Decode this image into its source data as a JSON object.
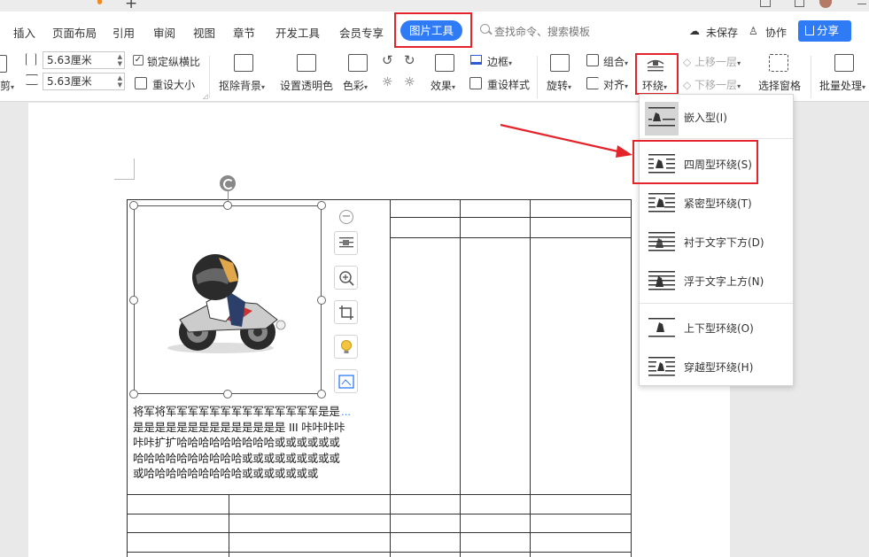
{
  "menubar": {
    "tabs": [
      "插入",
      "页面布局",
      "引用",
      "审阅",
      "视图",
      "章节",
      "开发工具",
      "会员专享"
    ],
    "active_tab": "图片工具",
    "search_placeholder": "查找命令、搜索模板",
    "unsaved": "未保存",
    "collaborate": "协作",
    "share": "分享"
  },
  "ribbon": {
    "crop": "剪",
    "width_value": "5.63厘米",
    "height_value": "5.63厘米",
    "lock_ratio": "锁定纵横比",
    "reset_size": "重设大小",
    "remove_bg": "抠除背景",
    "set_transparent": "设置透明色",
    "color": "色彩",
    "effects": "效果",
    "border": "边框",
    "reset_style": "重设样式",
    "rotate": "旋转",
    "group": "组合",
    "align": "对齐",
    "wrap": "环绕",
    "bring_forward": "上移一层",
    "send_backward": "下移一层",
    "selection_pane": "选择窗格",
    "batch": "批量处理"
  },
  "wrap_menu": {
    "items": [
      {
        "label": "嵌入型(I)",
        "icon": "wrap-inline-icon"
      },
      {
        "label": "四周型环绕(S)",
        "icon": "wrap-square-icon"
      },
      {
        "label": "紧密型环绕(T)",
        "icon": "wrap-tight-icon"
      },
      {
        "label": "衬于文字下方(D)",
        "icon": "wrap-behind-text-icon"
      },
      {
        "label": "浮于文字上方(N)",
        "icon": "wrap-in-front-icon"
      },
      {
        "label": "上下型环绕(O)",
        "icon": "wrap-top-bottom-icon"
      },
      {
        "label": "穿越型环绕(H)",
        "icon": "wrap-through-icon"
      }
    ]
  },
  "document": {
    "text_lines": [
      "将军将军军军军军军军军军军军军军军是是",
      "是是是是是是是是是是是是是是 III 咔咔咔咔",
      "咔咔扩扩哈哈哈哈哈哈哈哈哈或或或或或或",
      "哈哈哈哈哈哈哈哈哈哈或或或或或或或或或",
      "或哈哈哈哈哈哈哈哈哈或或或或或或或"
    ]
  },
  "colors": {
    "accent": "#2f7bf5",
    "highlight": "#e3242b"
  }
}
